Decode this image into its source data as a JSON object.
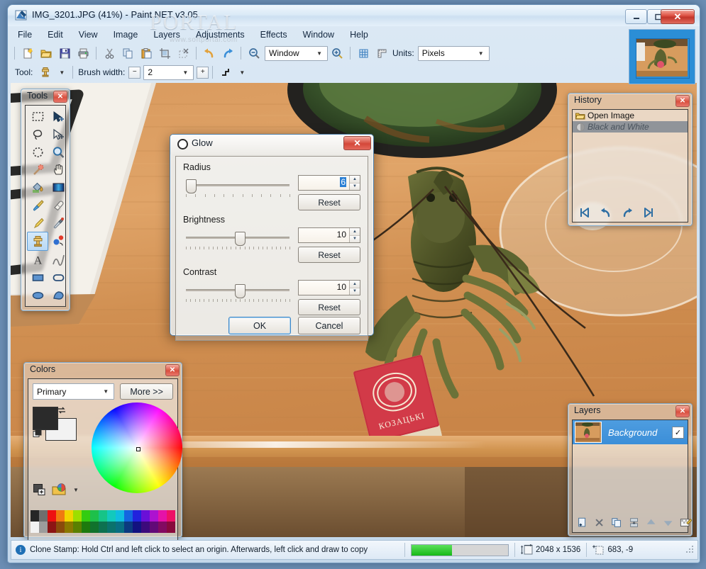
{
  "window": {
    "title": "IMG_3201.JPG (41%) - Paint.NET v3.05",
    "watermark": "PORTAL",
    "watermark_sub": "www.softportal.com",
    "minimize": "—",
    "maximize": "❐",
    "close": "✕"
  },
  "menu": [
    "File",
    "Edit",
    "View",
    "Image",
    "Layers",
    "Adjustments",
    "Effects",
    "Window",
    "Help"
  ],
  "toolbar": {
    "items": [
      "new-icon",
      "open-icon",
      "save-icon",
      "print-icon",
      "cut-icon",
      "copy-icon",
      "paste-icon",
      "crop-to-selection-icon",
      "deselect-icon",
      "undo-icon",
      "redo-icon",
      "zoom-out-icon"
    ],
    "zoom_value": "Window",
    "zoom_in_icon": "zoom-in-icon",
    "grid_icon": "grid-icon",
    "rulers_icon": "rulers-icon",
    "units_label": "Units:",
    "units_value": "Pixels"
  },
  "tooloptions": {
    "tool_label": "Tool:",
    "tool_icon": "clone-stamp-icon",
    "brush_label": "Brush width:",
    "brush_minus": "−",
    "brush_value": "2",
    "brush_plus": "+",
    "blending_icon": "blend-mode-icon"
  },
  "tools_palette": {
    "title": "Tools",
    "close": "✕",
    "items": [
      {
        "name": "rectangle-select-tool",
        "glyph": "▭"
      },
      {
        "name": "move-selected-tool",
        "glyph": "➤"
      },
      {
        "name": "lasso-select-tool",
        "glyph": "◠"
      },
      {
        "name": "move-selection-tool",
        "glyph": "➢"
      },
      {
        "name": "ellipse-select-tool",
        "glyph": "◯"
      },
      {
        "name": "zoom-tool",
        "glyph": "🔍"
      },
      {
        "name": "magic-wand-tool",
        "glyph": "✦"
      },
      {
        "name": "pan-tool",
        "glyph": "✋"
      },
      {
        "name": "paint-bucket-tool",
        "glyph": "🪣"
      },
      {
        "name": "gradient-tool",
        "glyph": "▤"
      },
      {
        "name": "paintbrush-tool",
        "glyph": "🖌"
      },
      {
        "name": "eraser-tool",
        "glyph": "▱"
      },
      {
        "name": "pencil-tool",
        "glyph": "✎"
      },
      {
        "name": "color-picker-tool",
        "glyph": "💉"
      },
      {
        "name": "clone-stamp-tool",
        "glyph": "⬒"
      },
      {
        "name": "recolor-tool",
        "glyph": "◍"
      },
      {
        "name": "text-tool",
        "glyph": "A"
      },
      {
        "name": "line-curve-tool",
        "glyph": "∿"
      },
      {
        "name": "rectangle-shape-tool",
        "glyph": "▬"
      },
      {
        "name": "rounded-rectangle-tool",
        "glyph": "▭"
      },
      {
        "name": "ellipse-shape-tool",
        "glyph": "⬭"
      },
      {
        "name": "freeform-shape-tool",
        "glyph": "◣"
      }
    ],
    "selected_index": 14
  },
  "history": {
    "title": "History",
    "close": "✕",
    "items": [
      {
        "label": "Open Image",
        "state": "done",
        "icon": "folder-icon"
      },
      {
        "label": "Black and White",
        "state": "undone",
        "icon": "adjustment-icon"
      }
    ],
    "nav": [
      {
        "name": "history-rewind-button",
        "glyph": "◀|"
      },
      {
        "name": "history-undo-button",
        "glyph": "↶"
      },
      {
        "name": "history-redo-button",
        "glyph": "↷"
      },
      {
        "name": "history-fast-forward-button",
        "glyph": "|▶"
      }
    ]
  },
  "colors": {
    "title": "Colors",
    "close": "✕",
    "mode_value": "Primary",
    "more_label": "More >>",
    "primary_hex": "#2b2b2b",
    "secondary_hex": "#f2f2f2",
    "swap_icon": "swap-colors-icon",
    "reset_icon": "reset-colors-icon",
    "add_palette_icon": "add-to-palette-icon",
    "palette_icon": "palette-folder-icon",
    "palette_row1": [
      "#262626",
      "#6e6e6e",
      "#ee1111",
      "#f07a10",
      "#f2d400",
      "#9ede00",
      "#33cc11",
      "#1ec04a",
      "#16c487",
      "#12c9bd",
      "#10bde0",
      "#1466e0",
      "#2222dd",
      "#6a10d8",
      "#ad12d0",
      "#e512a8",
      "#ee1166"
    ],
    "palette_row2": [
      "#f2f2f2",
      "#9c9c9c",
      "#8c1414",
      "#8a4a0b",
      "#8a7800",
      "#5a8000",
      "#1d7a0d",
      "#11722c",
      "#0d7150",
      "#0a726c",
      "#086e82",
      "#0b3a80",
      "#121280",
      "#3c0a7c",
      "#620a78",
      "#830a61",
      "#88093c"
    ]
  },
  "layers": {
    "title": "Layers",
    "close": "✕",
    "rows": [
      {
        "name": "Background",
        "visible": true,
        "check": "✓"
      }
    ],
    "nav": [
      {
        "name": "add-new-layer-button",
        "glyph": "🗋"
      },
      {
        "name": "delete-layer-button",
        "glyph": "✕"
      },
      {
        "name": "duplicate-layer-button",
        "glyph": "❐"
      },
      {
        "name": "merge-layer-down-button",
        "glyph": "⤓"
      },
      {
        "name": "move-layer-up-button",
        "glyph": "▲"
      },
      {
        "name": "move-layer-down-button",
        "glyph": "▼"
      },
      {
        "name": "layer-properties-button",
        "glyph": "🗒"
      }
    ]
  },
  "glow_dialog": {
    "title": "Glow",
    "close": "✕",
    "icon": "effect-glow-icon",
    "controls": [
      {
        "label": "Radius",
        "value": "6",
        "selected": true,
        "thumb_pct": 4,
        "reset": "Reset",
        "ticks": 12
      },
      {
        "label": "Brightness",
        "value": "10",
        "selected": false,
        "thumb_pct": 42,
        "reset": "Reset",
        "ticks": 24
      },
      {
        "label": "Contrast",
        "value": "10",
        "selected": false,
        "thumb_pct": 42,
        "reset": "Reset",
        "ticks": 24
      }
    ],
    "ok_label": "OK",
    "cancel_label": "Cancel"
  },
  "statusbar": {
    "hint_icon": "info-icon",
    "hint": "Clone Stamp: Hold Ctrl and left click to select an origin. Afterwards, left click and draw to copy",
    "progress_pct": 42,
    "size_icon": "image-size-icon",
    "size": "2048 x 1536",
    "cursor_icon": "cursor-position-icon",
    "cursor": "683, -9"
  },
  "accent": {
    "selection_blue": "#3b8ed8",
    "title_red": "#d4483a",
    "progress_green": "#16b816"
  }
}
